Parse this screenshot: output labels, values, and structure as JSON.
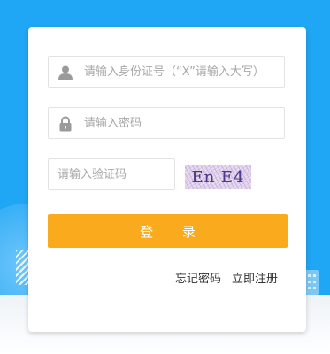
{
  "form": {
    "id_placeholder": "请输入身份证号（“X”请输入大写）",
    "password_placeholder": "请输入密码",
    "captcha_placeholder": "请输入验证码",
    "captcha_text": "En E4",
    "login_label": "登 录"
  },
  "links": {
    "forgot_password": "忘记密码",
    "register": "立即注册"
  },
  "colors": {
    "background": "#1fa6f5",
    "button": "#f9ab1d",
    "captcha_text_1": "#7a4a1c",
    "captcha_text_2": "#3a2b9a"
  },
  "icons": {
    "id_field": "user-icon",
    "password_field": "lock-icon"
  }
}
